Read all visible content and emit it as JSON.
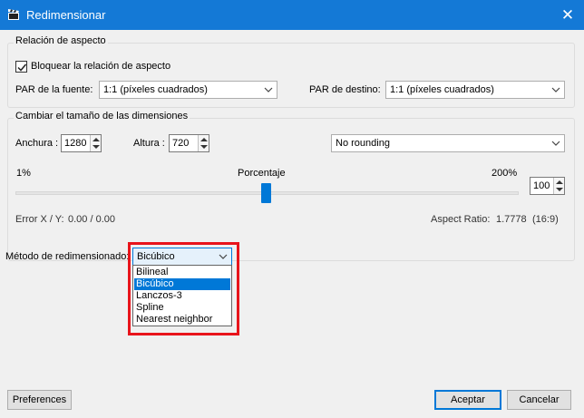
{
  "window": {
    "title": "Redimensionar",
    "close_glyph": "✕"
  },
  "aspect_group": {
    "title": "Relación de aspecto",
    "lock_label": "Bloquear la relación de aspecto",
    "lock_checked": true,
    "source_par_label": "PAR de la fuente:",
    "source_par_value": "1:1 (píxeles cuadrados)",
    "dest_par_label": "PAR de destino:",
    "dest_par_value": "1:1 (píxeles cuadrados)"
  },
  "size_group": {
    "title": "Cambiar el tamaño de las dimensiones",
    "width_label": "Anchura :",
    "width_value": "1280",
    "height_label": "Altura :",
    "height_value": "720",
    "rounding_value": "No rounding",
    "min_label": "1%",
    "percent_label": "Porcentaje",
    "max_label": "200%",
    "percent_value": "100",
    "error_label": "Error X / Y:",
    "error_value": "0.00 / 0.00",
    "aspect_ratio_label": "Aspect Ratio:",
    "aspect_ratio_value": "1.7778",
    "aspect_ratio_fraction": "(16:9)"
  },
  "resize_method": {
    "label": "Método de redimensionado:",
    "selected": "Bicúbico",
    "options": [
      "Bilineal",
      "Bicúbico",
      "Lanczos-3",
      "Spline",
      "Nearest neighbor"
    ],
    "highlighted_index": 1
  },
  "footer": {
    "preferences_label": "Preferences",
    "accept_label": "Aceptar",
    "cancel_label": "Cancelar"
  },
  "colors": {
    "titlebar": "#1479d6",
    "selection": "#0078d7",
    "highlight_border": "#e8141b"
  },
  "icons": {
    "app": "clapperboard-icon",
    "close": "close-icon",
    "dropdown": "chevron-down-icon",
    "checkbox": "checkmark-icon"
  }
}
